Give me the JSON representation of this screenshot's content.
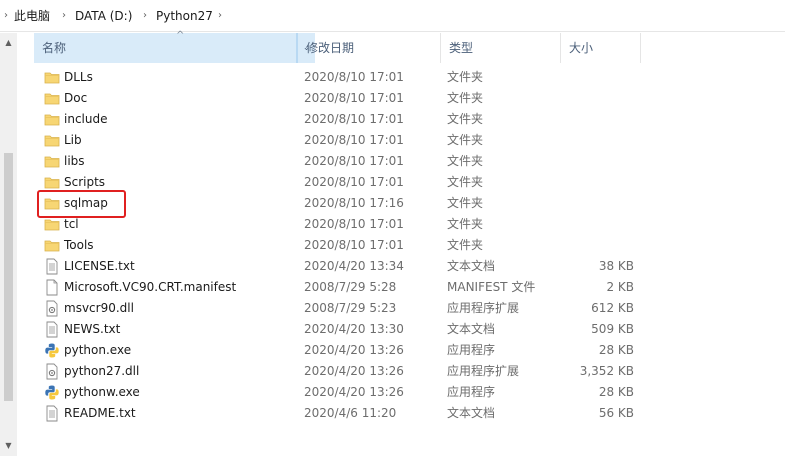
{
  "breadcrumb": {
    "items": [
      "此电脑",
      "DATA (D:)",
      "Python27"
    ],
    "separator": "›"
  },
  "columns": {
    "name": "名称",
    "date": "修改日期",
    "type": "类型",
    "size": "大小"
  },
  "colors": {
    "header_selected_bg": "#d9ebf9",
    "header_text": "#4c607a",
    "folder_yellow": "#f7d674",
    "highlight_border": "#e02020",
    "python_blue": "#3b74b4",
    "python_yellow": "#f6c83d"
  },
  "files": [
    {
      "name": "DLLs",
      "date": "2020/8/10 17:01",
      "type": "文件夹",
      "size": "",
      "icon": "folder-icon"
    },
    {
      "name": "Doc",
      "date": "2020/8/10 17:01",
      "type": "文件夹",
      "size": "",
      "icon": "folder-icon"
    },
    {
      "name": "include",
      "date": "2020/8/10 17:01",
      "type": "文件夹",
      "size": "",
      "icon": "folder-icon"
    },
    {
      "name": "Lib",
      "date": "2020/8/10 17:01",
      "type": "文件夹",
      "size": "",
      "icon": "folder-icon"
    },
    {
      "name": "libs",
      "date": "2020/8/10 17:01",
      "type": "文件夹",
      "size": "",
      "icon": "folder-icon"
    },
    {
      "name": "Scripts",
      "date": "2020/8/10 17:01",
      "type": "文件夹",
      "size": "",
      "icon": "folder-icon"
    },
    {
      "name": "sqlmap",
      "date": "2020/8/10 17:16",
      "type": "文件夹",
      "size": "",
      "icon": "folder-icon"
    },
    {
      "name": "tcl",
      "date": "2020/8/10 17:01",
      "type": "文件夹",
      "size": "",
      "icon": "folder-icon"
    },
    {
      "name": "Tools",
      "date": "2020/8/10 17:01",
      "type": "文件夹",
      "size": "",
      "icon": "folder-icon"
    },
    {
      "name": "LICENSE.txt",
      "date": "2020/4/20 13:34",
      "type": "文本文档",
      "size": "38 KB",
      "icon": "text-file-icon"
    },
    {
      "name": "Microsoft.VC90.CRT.manifest",
      "date": "2008/7/29 5:28",
      "type": "MANIFEST 文件",
      "size": "2 KB",
      "icon": "blank-file-icon"
    },
    {
      "name": "msvcr90.dll",
      "date": "2008/7/29 5:23",
      "type": "应用程序扩展",
      "size": "612 KB",
      "icon": "dll-file-icon"
    },
    {
      "name": "NEWS.txt",
      "date": "2020/4/20 13:30",
      "type": "文本文档",
      "size": "509 KB",
      "icon": "text-file-icon"
    },
    {
      "name": "python.exe",
      "date": "2020/4/20 13:26",
      "type": "应用程序",
      "size": "28 KB",
      "icon": "python-icon"
    },
    {
      "name": "python27.dll",
      "date": "2020/4/20 13:26",
      "type": "应用程序扩展",
      "size": "3,352 KB",
      "icon": "dll-file-icon"
    },
    {
      "name": "pythonw.exe",
      "date": "2020/4/20 13:26",
      "type": "应用程序",
      "size": "28 KB",
      "icon": "python-icon"
    },
    {
      "name": "README.txt",
      "date": "2020/4/6 11:20",
      "type": "文本文档",
      "size": "56 KB",
      "icon": "text-file-icon"
    }
  ]
}
